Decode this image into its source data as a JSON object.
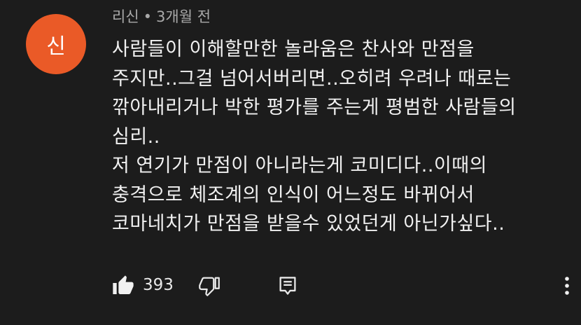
{
  "comment": {
    "avatar_initial": "신",
    "avatar_color": "#ea5a27",
    "author": "리신",
    "separator": "•",
    "time": "3개월 전",
    "lines": [
      "사람들이 이해할만한 놀라움은 찬사와 만점을",
      "주지만..그걸 넘어서버리면..오히려 우려나 때로는",
      "깎아내리거나 박한 평가를 주는게 평범한 사람들의",
      "심리..",
      "저 연기가 만점이 아니라는게 코미디다..이때의",
      "충격으로 체조계의 인식이 어느정도 바뀌어서",
      "코마네치가 만점을 받을수 있었던게 아닌가싶다.."
    ]
  },
  "actions": {
    "like_icon": "thumbs-up-icon",
    "like_count": "393",
    "dislike_icon": "thumbs-down-icon",
    "reply_icon": "reply-comment-icon",
    "more_icon": "more-vertical-icon"
  }
}
